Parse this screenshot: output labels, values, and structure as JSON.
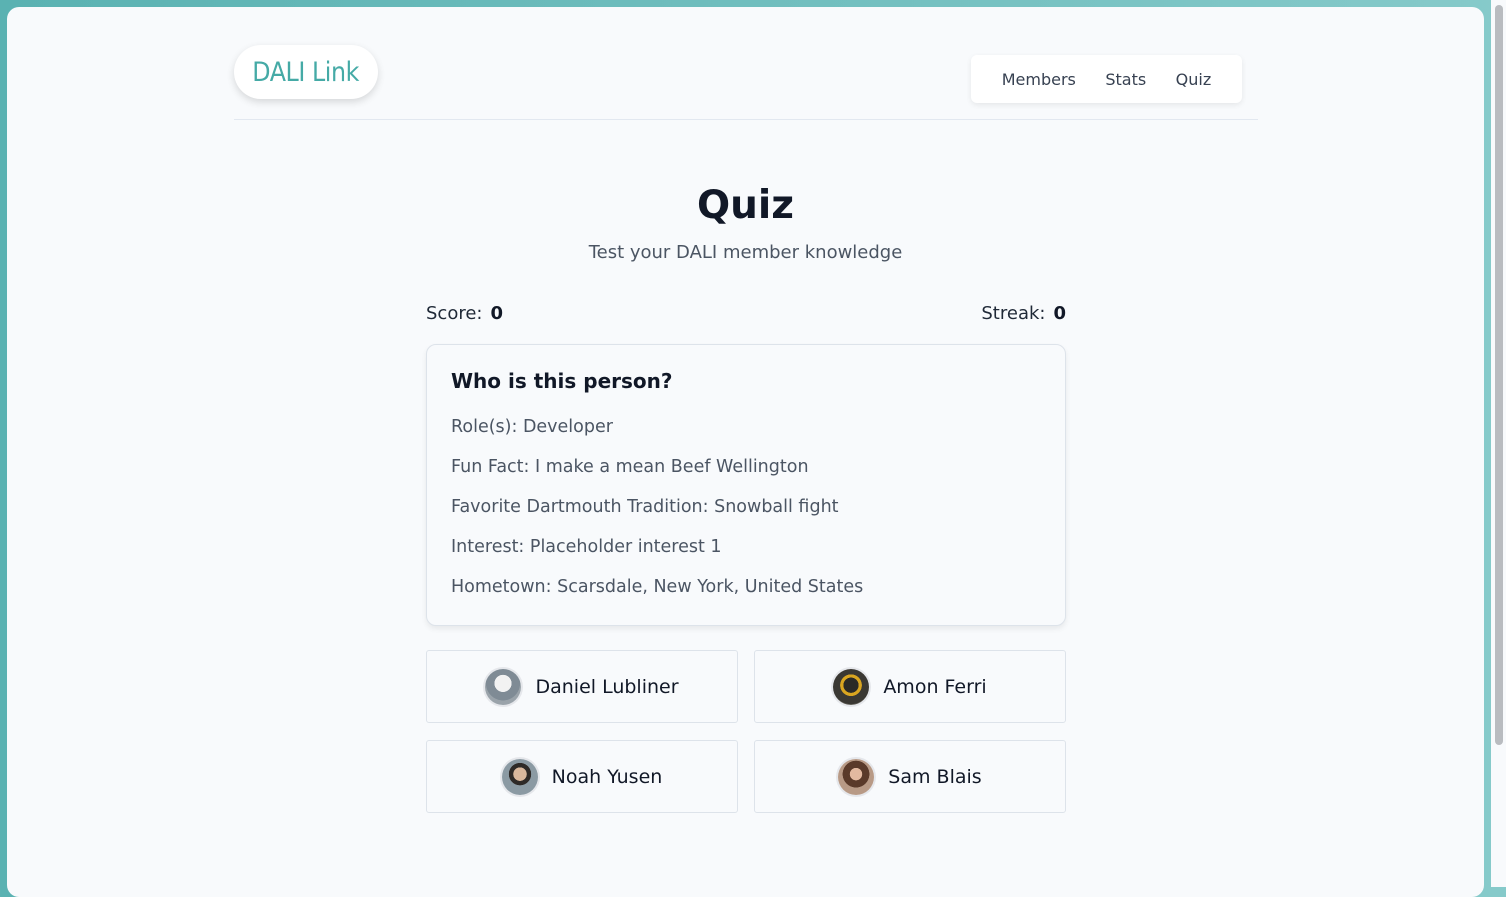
{
  "app": {
    "logo_text": "DALI Link",
    "accent_color": "#45aaa6"
  },
  "nav": {
    "items": [
      {
        "label": "Members"
      },
      {
        "label": "Stats"
      },
      {
        "label": "Quiz"
      }
    ]
  },
  "page": {
    "title": "Quiz",
    "subtitle": "Test your DALI member knowledge"
  },
  "scoreboard": {
    "score_label": "Score:",
    "score_value": "0",
    "streak_label": "Streak:",
    "streak_value": "0"
  },
  "question": {
    "prompt": "Who is this person?",
    "clues": [
      "Role(s): Developer",
      "Fun Fact: I make a mean Beef Wellington",
      "Favorite Dartmouth Tradition: Snowball fight",
      "Interest: Placeholder interest 1",
      "Hometown: Scarsdale, New York, United States"
    ]
  },
  "choices": [
    {
      "name": "Daniel Lubliner",
      "avatar_icon": "person-avatar"
    },
    {
      "name": "Amon Ferri",
      "avatar_icon": "statue-avatar"
    },
    {
      "name": "Noah Yusen",
      "avatar_icon": "person-avatar"
    },
    {
      "name": "Sam Blais",
      "avatar_icon": "person-avatar"
    }
  ]
}
